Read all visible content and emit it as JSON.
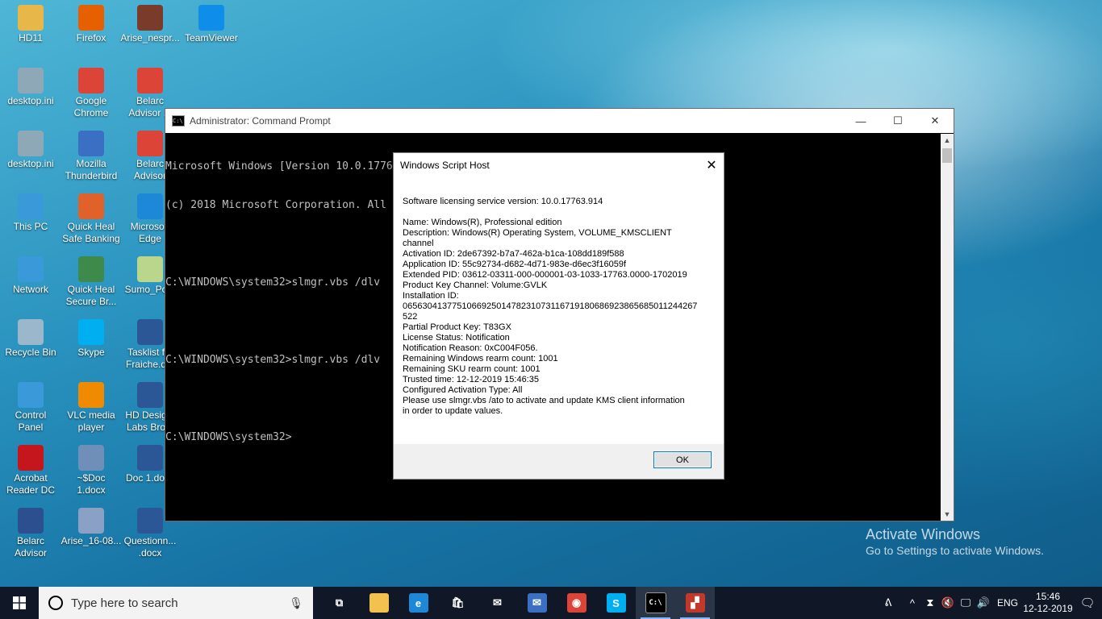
{
  "desktop": {
    "icons": [
      {
        "label": "HD11",
        "icon": "folder-icon",
        "color": "#e8b74a"
      },
      {
        "label": "Firefox",
        "icon": "firefox-icon",
        "color": "#e66000"
      },
      {
        "label": "Arise_nespr...",
        "icon": "image-icon",
        "color": "#7a3b2a"
      },
      {
        "label": "TeamViewer",
        "icon": "teamviewer-icon",
        "color": "#0e8ee9"
      },
      {
        "label": "desktop.ini",
        "icon": "settings-file-icon",
        "color": "#8ea8b8"
      },
      {
        "label": "Google\nChrome",
        "icon": "chrome-icon",
        "color": "#db4437"
      },
      {
        "label": "Belarc\nAdvisor ...",
        "icon": "chrome-icon",
        "color": "#db4437"
      },
      {
        "label": "desktop.ini",
        "icon": "settings-file-icon",
        "color": "#8ea8b8"
      },
      {
        "label": "Mozilla\nThunderbird",
        "icon": "thunderbird-icon",
        "color": "#3a6fc4"
      },
      {
        "label": "Belarc\nAdvisor",
        "icon": "chrome-icon",
        "color": "#db4437"
      },
      {
        "label": "This PC",
        "icon": "this-pc-icon",
        "color": "#3a9ad9"
      },
      {
        "label": "Quick Heal\nSafe Banking",
        "icon": "quick-heal-banking-icon",
        "color": "#e0612a"
      },
      {
        "label": "Microsoft\nEdge",
        "icon": "edge-icon",
        "color": "#1e88d8"
      },
      {
        "label": "Network",
        "icon": "network-icon",
        "color": "#3a9ad9"
      },
      {
        "label": "Quick Heal\nSecure Br...",
        "icon": "quick-heal-browser-icon",
        "color": "#3d8a4a"
      },
      {
        "label": "Sumo_Po...",
        "icon": "sumo-icon",
        "color": "#b9d68c"
      },
      {
        "label": "Recycle Bin",
        "icon": "recycle-bin-icon",
        "color": "#9ab7cc"
      },
      {
        "label": "Skype",
        "icon": "skype-icon",
        "color": "#00aff0"
      },
      {
        "label": "Tasklist f...\nFraiche.d...",
        "icon": "word-doc-icon",
        "color": "#2b5797"
      },
      {
        "label": "Control\nPanel",
        "icon": "control-panel-icon",
        "color": "#3a9ad9"
      },
      {
        "label": "VLC media\nplayer",
        "icon": "vlc-icon",
        "color": "#f08a00"
      },
      {
        "label": "HD Desig...\nLabs Bro...",
        "icon": "word-doc-icon",
        "color": "#2b5797"
      },
      {
        "label": "Acrobat\nReader DC",
        "icon": "acrobat-icon",
        "color": "#c4161c"
      },
      {
        "label": "~$Doc\n1.docx",
        "icon": "word-doc-icon",
        "color": "#6f8fb8"
      },
      {
        "label": "Doc 1.docx",
        "icon": "word-doc-icon",
        "color": "#2b5797"
      },
      {
        "label": "Belarc\nAdvisor",
        "icon": "belarc-icon",
        "color": "#2b4f8f"
      },
      {
        "label": "Arise_16-08...",
        "icon": "image-icon",
        "color": "#8aa0c4"
      },
      {
        "label": "Questionn...\n.docx",
        "icon": "word-doc-icon",
        "color": "#2b5797"
      }
    ]
  },
  "cmd": {
    "title": "Administrator: Command Prompt",
    "lines": [
      "Microsoft Windows [Version 10.0.17763.914]",
      "(c) 2018 Microsoft Corporation. All rights reserved.",
      "",
      "C:\\WINDOWS\\system32>slmgr.vbs /dlv",
      "",
      "C:\\WINDOWS\\system32>slmgr.vbs /dlv",
      "",
      "C:\\WINDOWS\\system32>"
    ]
  },
  "dialog": {
    "title": "Windows Script Host",
    "lines": [
      "Software licensing service version: 10.0.17763.914",
      "",
      "Name: Windows(R), Professional edition",
      "Description: Windows(R) Operating System, VOLUME_KMSCLIENT",
      "channel",
      "Activation ID: 2de67392-b7a7-462a-b1ca-108dd189f588",
      "Application ID: 55c92734-d682-4d71-983e-d6ec3f16059f",
      "Extended PID: 03612-03311-000-000001-03-1033-17763.0000-1702019",
      "Product Key Channel: Volume:GVLK",
      "Installation ID:",
      "065630413775106692501478231073116719180686923865685011244267",
      "522",
      "Partial Product Key: T83GX",
      "License Status: Notification",
      "Notification Reason: 0xC004F056.",
      "Remaining Windows rearm count: 1001",
      "Remaining SKU rearm count: 1001",
      "Trusted time: 12-12-2019 15:46:35",
      "Configured Activation Type: All",
      "Please use slmgr.vbs /ato to activate and update KMS client information",
      "in order to update values."
    ],
    "ok_label": "OK"
  },
  "watermark": {
    "line1": "Activate Windows",
    "line2": "Go to Settings to activate Windows."
  },
  "taskbar": {
    "search_placeholder": "Type here to search",
    "apps": [
      {
        "name": "task-view",
        "icon": "task-view-icon",
        "glyph": "⧉",
        "color": "#101827"
      },
      {
        "name": "file-explorer",
        "icon": "folder-icon",
        "glyph": "",
        "color": "#f2c14e"
      },
      {
        "name": "edge",
        "icon": "edge-icon",
        "glyph": "e",
        "color": "#1e88d8"
      },
      {
        "name": "store",
        "icon": "store-icon",
        "glyph": "🛍",
        "color": "#101827"
      },
      {
        "name": "mail",
        "icon": "mail-icon",
        "glyph": "✉",
        "color": "#101827"
      },
      {
        "name": "thunderbird",
        "icon": "thunderbird-icon",
        "glyph": "✉",
        "color": "#3a6fc4"
      },
      {
        "name": "chrome",
        "icon": "chrome-icon",
        "glyph": "◉",
        "color": "#db4437"
      },
      {
        "name": "skype",
        "icon": "skype-icon",
        "glyph": "S",
        "color": "#00aff0"
      },
      {
        "name": "command-prompt",
        "icon": "cmd-icon",
        "glyph": "C:\\",
        "color": "#000000"
      },
      {
        "name": "script-host",
        "icon": "script-host-icon",
        "glyph": "▞",
        "color": "#c0392b"
      }
    ],
    "tray": {
      "language": "ENG",
      "time": "15:46",
      "date": "12-12-2019"
    }
  }
}
